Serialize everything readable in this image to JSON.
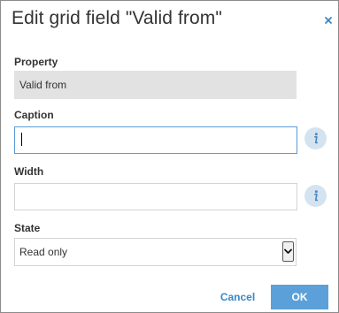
{
  "dialog": {
    "title": "Edit grid field \"Valid from\""
  },
  "fields": {
    "property": {
      "label": "Property",
      "value": "Valid from"
    },
    "caption": {
      "label": "Caption",
      "value": "",
      "info_icon": "info-icon"
    },
    "width": {
      "label": "Width",
      "value": "",
      "info_icon": "info-icon"
    },
    "state": {
      "label": "State",
      "selected": "Read only"
    }
  },
  "buttons": {
    "cancel_label": "Cancel",
    "ok_label": "OK"
  },
  "icons": {
    "close": "close-icon",
    "dropdown": "chevron-down-icon"
  },
  "colors": {
    "accent": "#5ba0d8",
    "link": "#3a87c8",
    "info_bg": "#d4e3f0",
    "readonly_bg": "#e2e2e2"
  }
}
